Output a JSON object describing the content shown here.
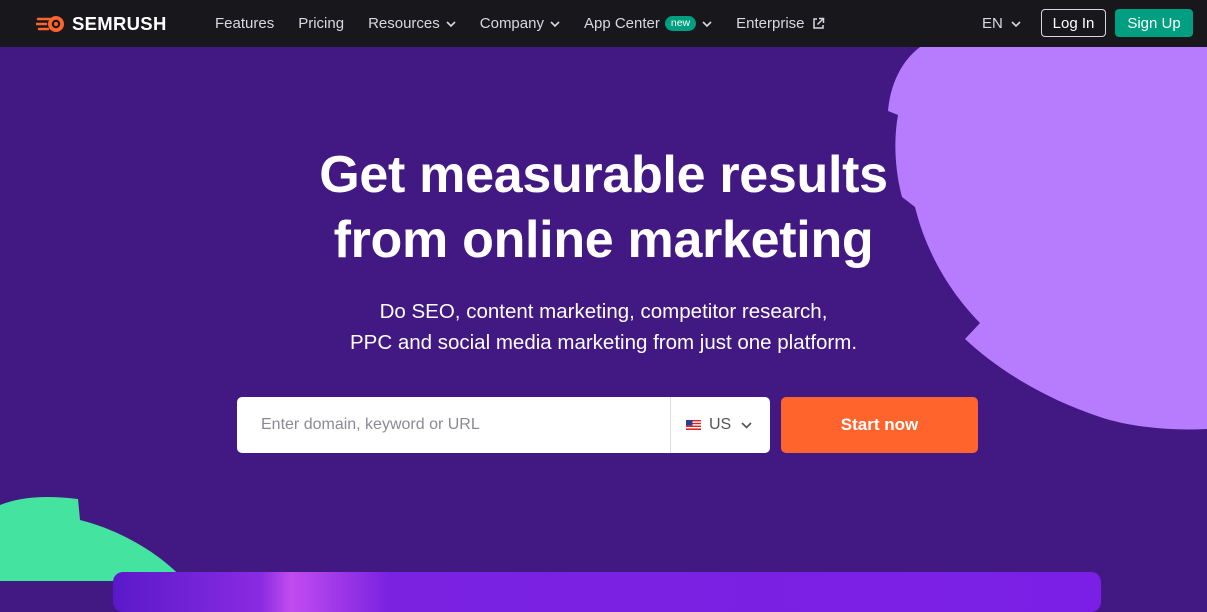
{
  "brand": {
    "name": "SEMRUSH",
    "accent": "#ff642d",
    "green": "#009f81",
    "hero_bg": "#421983"
  },
  "nav": {
    "items": [
      {
        "label": "Features",
        "icon": ""
      },
      {
        "label": "Pricing",
        "icon": ""
      },
      {
        "label": "Resources",
        "icon": "chevron-down-icon"
      },
      {
        "label": "Company",
        "icon": "chevron-down-icon"
      },
      {
        "label": "App Center",
        "badge": "new",
        "icon": "chevron-down-icon"
      },
      {
        "label": "Enterprise",
        "icon": "external-link-icon"
      }
    ],
    "language": "EN",
    "login_label": "Log In",
    "signup_label": "Sign Up"
  },
  "hero": {
    "title_line1": "Get measurable results",
    "title_line2": "from online marketing",
    "subtitle_line1": "Do SEO, content marketing, competitor research,",
    "subtitle_line2": "PPC and social media marketing from just one platform."
  },
  "search": {
    "placeholder": "Enter domain, keyword or URL",
    "value": "",
    "country": "US",
    "submit_label": "Start now"
  }
}
